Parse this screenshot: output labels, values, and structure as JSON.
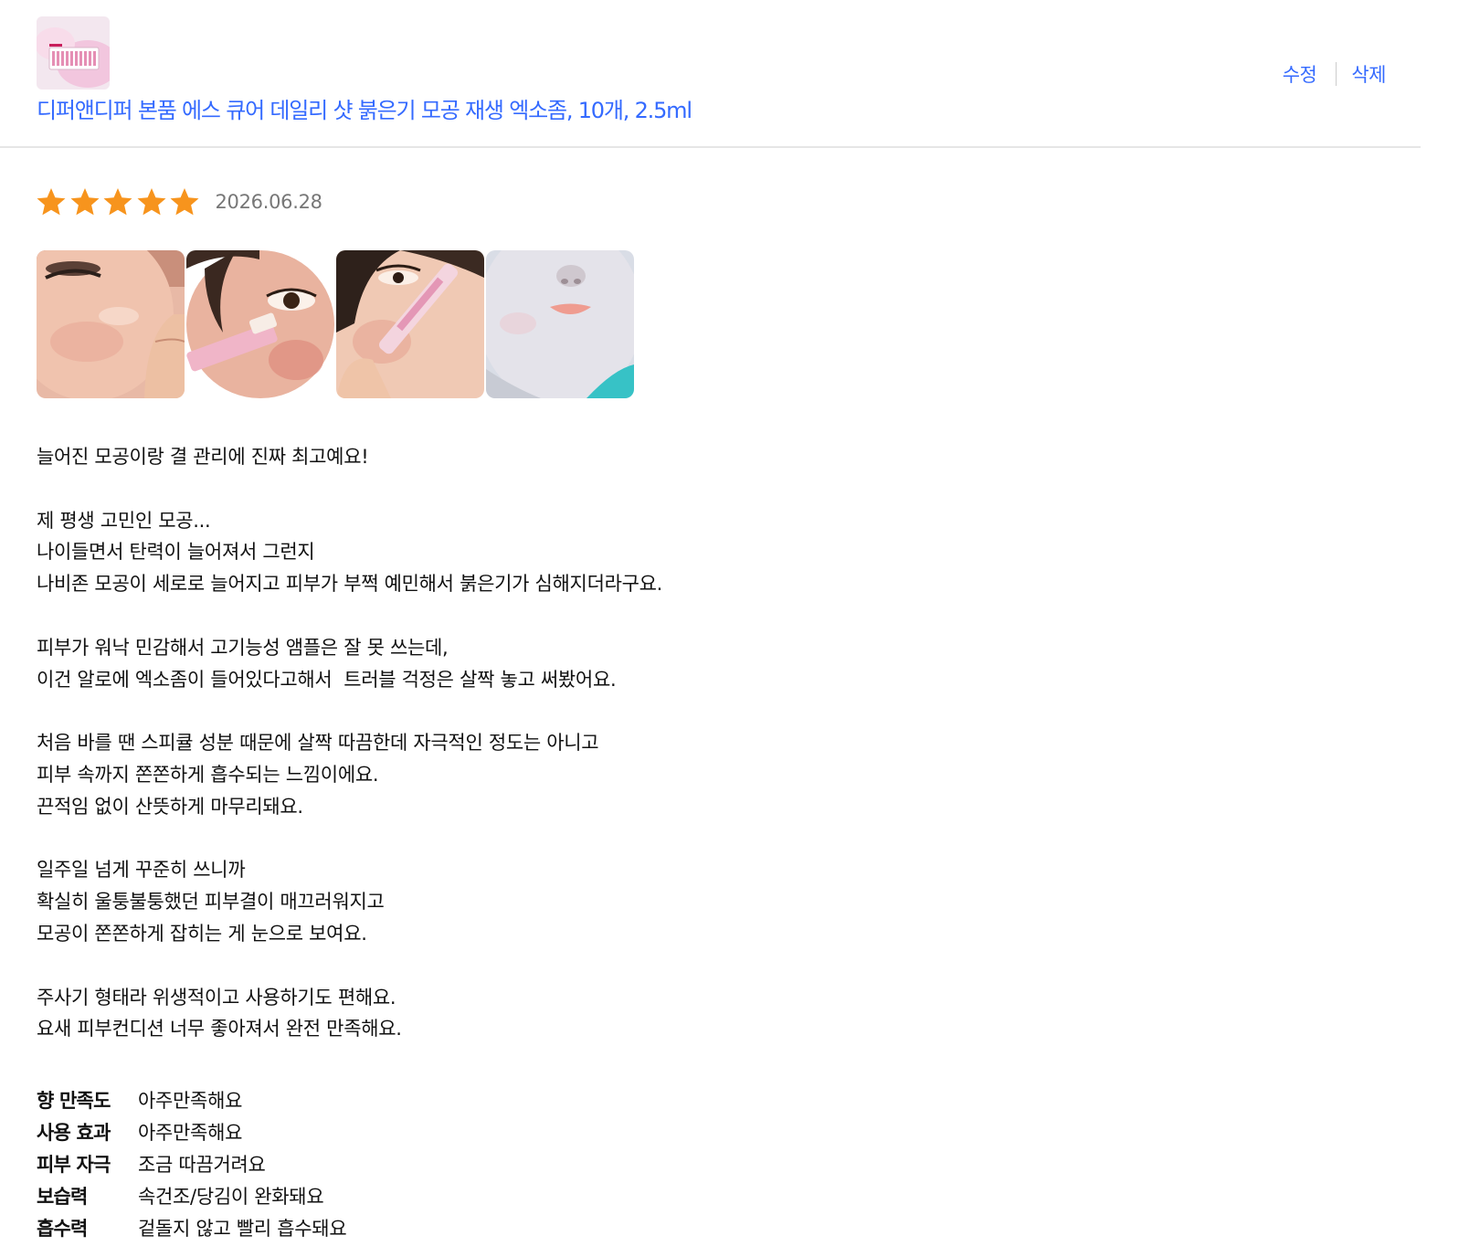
{
  "product": {
    "title": "디퍼앤디퍼 본품 에스 큐어 데일리 샷 붉은기 모공 재생 엑소좀, 10개, 2.5ml",
    "thumbnail_icon": "product-ampoule-box-image"
  },
  "actions": {
    "edit_label": "수정",
    "delete_label": "삭제"
  },
  "review": {
    "rating": 5,
    "rating_max": 5,
    "date": "2026.06.28",
    "star_color": "#f7941d",
    "photos": [
      "face-cheek-photo",
      "ampoule-eye-photo",
      "ampoule-syringe-photo",
      "smiling-face-photo"
    ],
    "paragraphs": [
      [
        "늘어진 모공이랑 결 관리에 진짜 최고예요!"
      ],
      [
        "제 평생 고민인 모공...",
        "나이들면서 탄력이 늘어져서 그런지",
        "나비존 모공이 세로로 늘어지고 피부가 부쩍 예민해서 붉은기가 심해지더라구요."
      ],
      [
        "피부가 워낙 민감해서 고기능성 앰플은 잘 못 쓰는데,",
        "이건 알로에 엑소좀이 들어있다고해서  트러블 걱정은 살짝 놓고 써봤어요."
      ],
      [
        "처음 바를 땐 스피큘 성분 때문에 살짝 따끔한데 자극적인 정도는 아니고",
        "피부 속까지 쫀쫀하게 흡수되는 느낌이에요.",
        "끈적임 없이 산뜻하게 마무리돼요."
      ],
      [
        "일주일 넘게 꾸준히 쓰니까",
        "확실히 울퉁불퉁했던 피부결이 매끄러워지고",
        "모공이 쫀쫀하게 잡히는 게 눈으로 보여요."
      ],
      [
        "주사기 형태라 위생적이고 사용하기도 편해요.",
        "요새 피부컨디션 너무 좋아져서 완전 만족해요."
      ]
    ]
  },
  "survey": [
    {
      "question": "향 만족도",
      "answer": "아주만족해요"
    },
    {
      "question": "사용 효과",
      "answer": "아주만족해요"
    },
    {
      "question": "피부 자극",
      "answer": "조금 따끔거려요"
    },
    {
      "question": "보습력",
      "answer": "속건조/당김이 완화돼요"
    },
    {
      "question": "흡수력",
      "answer": "겉돌지 않고 빨리 흡수돼요"
    }
  ],
  "colors": {
    "link": "#346aff",
    "divider": "#e6e6e6",
    "date": "#777777"
  }
}
